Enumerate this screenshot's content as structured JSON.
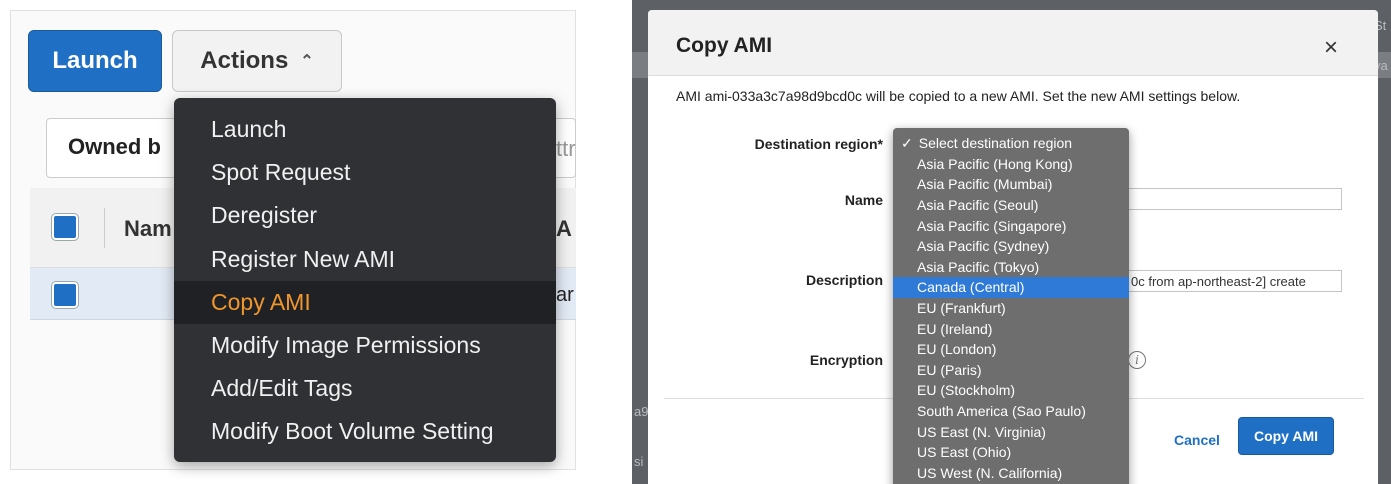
{
  "left": {
    "launch_label": "Launch",
    "actions_label": "Actions",
    "actions_caret": "⌃",
    "filter_owned": "Owned b",
    "filter_attr": "ttr",
    "col_name": "Nam",
    "col_a": "A",
    "row_fragment": "ar",
    "menu_items": [
      {
        "label": "Launch"
      },
      {
        "label": "Spot Request"
      },
      {
        "label": "Deregister"
      },
      {
        "label": "Register New AMI"
      },
      {
        "label": "Copy AMI"
      },
      {
        "label": "Modify Image Permissions"
      },
      {
        "label": "Add/Edit Tags"
      },
      {
        "label": "Modify Boot Volume Setting"
      }
    ],
    "active_menu_index": 4,
    "active_color": "#f0962d"
  },
  "right": {
    "title": "Copy AMI",
    "close": "×",
    "intro": "AMI ami-033a3c7a98d9bcd0c will be copied to a new AMI. Set the new AMI settings below.",
    "labels": {
      "region": "Destination region*",
      "name": "Name",
      "description": "Description",
      "encryption": "Encryption"
    },
    "description_value": "0c from ap-northeast-2] create",
    "encryption_fragment": "ts",
    "info_icon": "i",
    "cancel_label": "Cancel",
    "copy_label": "Copy AMI",
    "bg_fragments": {
      "top_right": "St",
      "top_right2": "va",
      "left1": "a9",
      "left2": "si"
    },
    "region_options": [
      {
        "label": "Select destination region",
        "checked": true
      },
      {
        "label": "Asia Pacific (Hong Kong)"
      },
      {
        "label": "Asia Pacific (Mumbai)"
      },
      {
        "label": "Asia Pacific (Seoul)"
      },
      {
        "label": "Asia Pacific (Singapore)"
      },
      {
        "label": "Asia Pacific (Sydney)"
      },
      {
        "label": "Asia Pacific (Tokyo)"
      },
      {
        "label": "Canada (Central)",
        "highlighted": true
      },
      {
        "label": "EU (Frankfurt)"
      },
      {
        "label": "EU (Ireland)"
      },
      {
        "label": "EU (London)"
      },
      {
        "label": "EU (Paris)"
      },
      {
        "label": "EU (Stockholm)"
      },
      {
        "label": "South America (Sao Paulo)"
      },
      {
        "label": "US East (N. Virginia)"
      },
      {
        "label": "US East (Ohio)"
      },
      {
        "label": "US West (N. California)"
      }
    ],
    "check_mark": "✓",
    "highlight_color": "#2f7ad6",
    "primary_color": "#1f6fc5"
  }
}
